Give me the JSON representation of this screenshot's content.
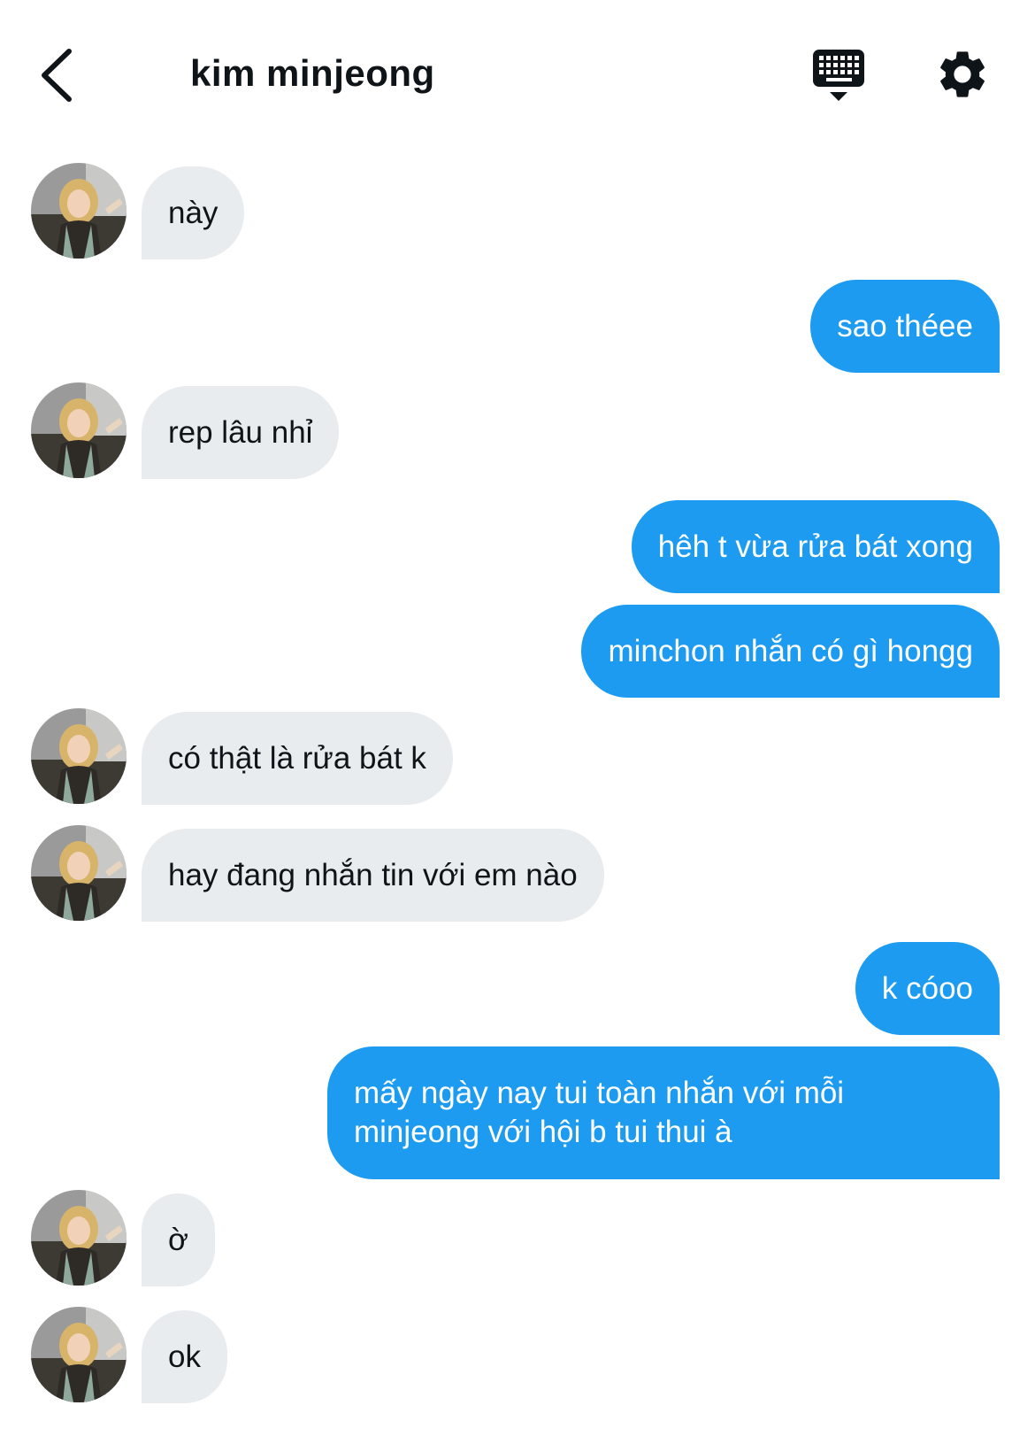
{
  "header": {
    "title": "kim minjeong",
    "back_icon": "chevron-left-icon",
    "keyboard_icon": "keyboard-icon",
    "settings_icon": "gear-icon"
  },
  "colors": {
    "incoming_bubble": "#e8ecef",
    "outgoing_bubble": "#1d9bf0",
    "incoming_text": "#0f1419",
    "outgoing_text": "#ffffff"
  },
  "messages": [
    {
      "from": "them",
      "text": "này"
    },
    {
      "from": "me",
      "text": "sao théee"
    },
    {
      "from": "them",
      "text": "rep lâu nhỉ"
    },
    {
      "from": "me",
      "text": "hêh t vừa rửa bát xong"
    },
    {
      "from": "me",
      "text": "minchon nhắn có gì hongg"
    },
    {
      "from": "them",
      "text": "có thật là rửa bát k"
    },
    {
      "from": "them",
      "text": "hay đang nhắn tin với em nào"
    },
    {
      "from": "me",
      "text": "k cóoo"
    },
    {
      "from": "me",
      "text": "mấy ngày nay tui toàn nhắn với mỗi minjeong với hội b tui thui à"
    },
    {
      "from": "them",
      "text": "ờ"
    },
    {
      "from": "them",
      "text": "ok"
    }
  ]
}
